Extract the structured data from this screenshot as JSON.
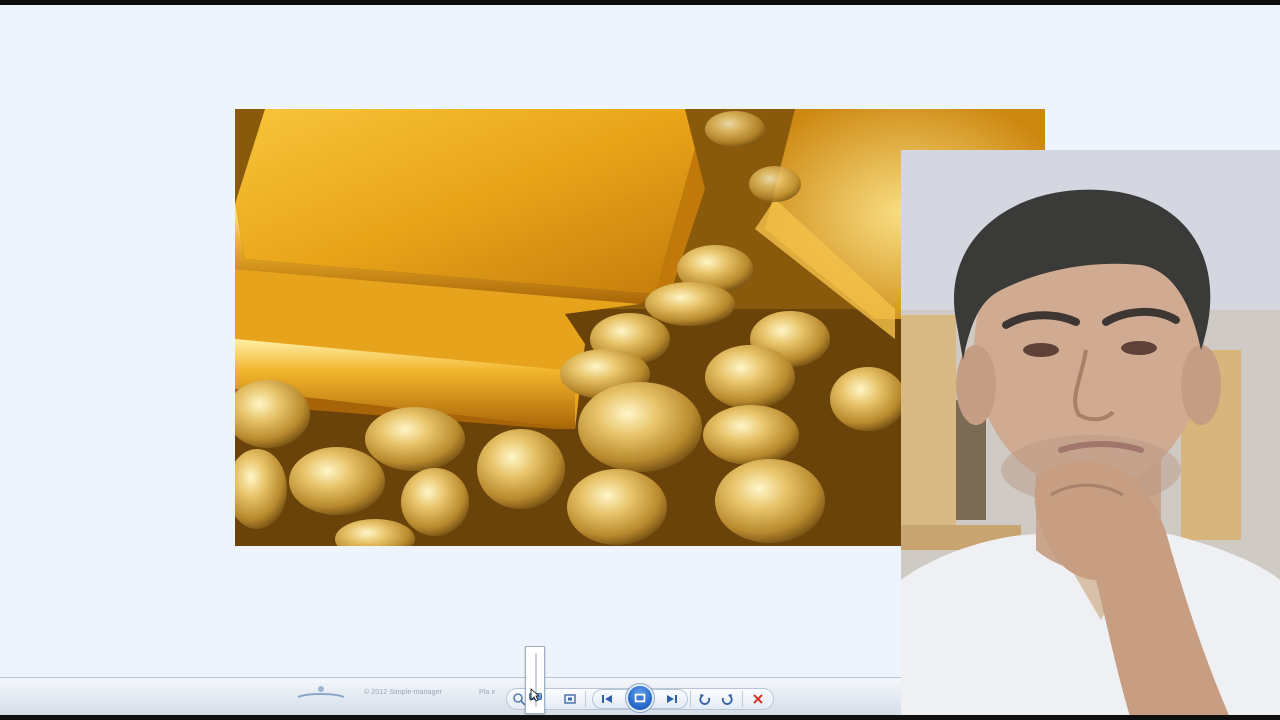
{
  "viewer": {
    "background": "#eef4fb",
    "image_subject": "gold bars and gold nuggets"
  },
  "toolbar": {
    "brand_text": "© 2012 Simple-manager",
    "secondary_text": "Pla ir",
    "zoom_level": 0.15,
    "controls": [
      {
        "name": "zoom-button",
        "icon": "magnifier-icon"
      },
      {
        "name": "actual-size-button",
        "icon": "fit-window-icon"
      },
      {
        "name": "previous-button",
        "icon": "skip-previous-icon"
      },
      {
        "name": "slideshow-button",
        "icon": "slideshow-icon"
      },
      {
        "name": "next-button",
        "icon": "skip-next-icon"
      },
      {
        "name": "rotate-left-button",
        "icon": "rotate-ccw-icon"
      },
      {
        "name": "rotate-right-button",
        "icon": "rotate-cw-icon"
      },
      {
        "name": "delete-button",
        "icon": "delete-x-icon"
      }
    ],
    "accent": "#2d6fd0",
    "delete_color": "#d23a2a"
  },
  "webcam": {
    "subject": "presenter in white t-shirt, hand on chin"
  }
}
